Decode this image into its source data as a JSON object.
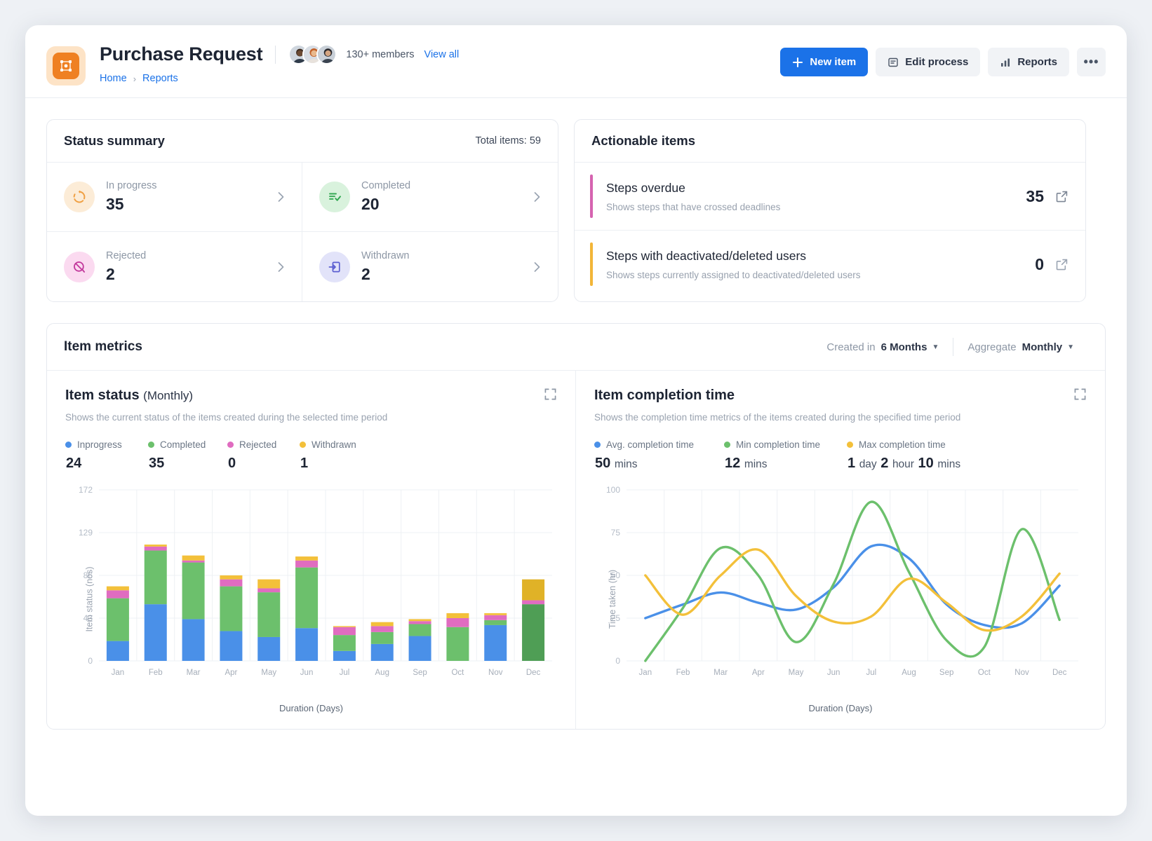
{
  "header": {
    "app_icon": "grid-app-icon",
    "title": "Purchase Request",
    "members_count": "130+ members",
    "view_all": "View all",
    "breadcrumb": {
      "home": "Home",
      "separator": "›",
      "current": "Reports"
    },
    "actions": {
      "new_item": "New item",
      "edit_process": "Edit process",
      "reports": "Reports",
      "more": "•••"
    },
    "accent_blue": "#1b72e8",
    "icon_orange": "#ef8022"
  },
  "status_summary": {
    "title": "Status summary",
    "total_label": "Total items: 59",
    "tiles": [
      {
        "label": "In progress",
        "value": "35",
        "icon": "in-progress-icon",
        "bg": "#fcecd7",
        "fg": "#f0a043"
      },
      {
        "label": "Completed",
        "value": "20",
        "icon": "completed-icon",
        "bg": "#d9f2dd",
        "fg": "#34a853"
      },
      {
        "label": "Rejected",
        "value": "2",
        "icon": "rejected-icon",
        "bg": "#fbdaf0",
        "fg": "#c2379b"
      },
      {
        "label": "Withdrawn",
        "value": "2",
        "icon": "withdrawn-icon",
        "bg": "#e2e3f9",
        "fg": "#5c5fd1"
      }
    ]
  },
  "actionable_items": {
    "title": "Actionable items",
    "rows": [
      {
        "title": "Steps overdue",
        "subtitle": "Shows steps that have crossed deadlines",
        "value": "35",
        "bar_color": "#d563b0"
      },
      {
        "title": "Steps with deactivated/deleted users",
        "subtitle": "Shows steps currently assigned to deactivated/deleted users",
        "value": "0",
        "bar_color": "#f2b538"
      }
    ]
  },
  "item_metrics": {
    "title": "Item metrics",
    "created_in": {
      "label": "Created in",
      "value": "6 Months"
    },
    "aggregate": {
      "label": "Aggregate",
      "value": "Monthly"
    }
  },
  "item_status": {
    "title": "Item status",
    "subtitle": "(Monthly)",
    "description": "Shows the current status of the items created during the selected time period",
    "expand_icon": "expand-icon",
    "legend": [
      {
        "label": "Inprogress",
        "value": "24",
        "color": "#4a90e8"
      },
      {
        "label": "Completed",
        "value": "35",
        "color": "#6cc06c"
      },
      {
        "label": "Rejected",
        "value": "0",
        "color": "#e06cc0"
      },
      {
        "label": "Withdrawn",
        "value": "1",
        "color": "#f3c03a"
      }
    ]
  },
  "item_completion": {
    "title": "Item completion time",
    "description": "Shows the completion time metrics of the items created during the specified time period",
    "expand_icon": "expand-icon",
    "legend": [
      {
        "label": "Avg. completion time",
        "value": "50",
        "unit": "mins",
        "color": "#4a90e8"
      },
      {
        "label": "Min completion time",
        "value": "12",
        "unit": "mins",
        "color": "#6cc06c"
      },
      {
        "label": "Max completion time",
        "value": "1",
        "unit": "day",
        "value2": "2",
        "unit2": "hour",
        "value3": "10",
        "unit3": "mins",
        "color": "#f3c03a"
      }
    ]
  },
  "chart_data": [
    {
      "type": "bar",
      "id": "item-status-bar",
      "title": "Item status (Monthly)",
      "stacked": true,
      "xlabel": "Duration (Days)",
      "ylabel": "Item status (nos)",
      "ylim": [
        0,
        172
      ],
      "yticks": [
        0,
        43,
        86,
        129,
        172
      ],
      "grid": true,
      "legend_position": "top-left",
      "categories": [
        "Jan",
        "Feb",
        "Mar",
        "Apr",
        "May",
        "Jun",
        "Jul",
        "Aug",
        "Sep",
        "Oct",
        "Nov",
        "Dec"
      ],
      "series": [
        {
          "name": "Inprogress",
          "color": "#4a90e8",
          "values": [
            20,
            57,
            42,
            30,
            24,
            33,
            10,
            17,
            25,
            0,
            36,
            0
          ]
        },
        {
          "name": "Completed",
          "color": "#6cc06c",
          "values": [
            43,
            54,
            57,
            45,
            45,
            61,
            16,
            12,
            12,
            34,
            5,
            57
          ]
        },
        {
          "name": "Rejected",
          "color": "#e06cc0",
          "values": [
            8,
            4,
            2,
            7,
            4,
            7,
            8,
            6,
            3,
            9,
            5,
            4
          ]
        },
        {
          "name": "Withdrawn",
          "color": "#f3c03a",
          "values": [
            4,
            2,
            5,
            4,
            9,
            4,
            1,
            4,
            2,
            5,
            2,
            21
          ]
        }
      ],
      "highlighted_category": "Dec"
    },
    {
      "type": "line",
      "id": "item-completion-line",
      "title": "Item completion time",
      "xlabel": "Duration (Days)",
      "ylabel": "Time taken (hr)",
      "ylim": [
        0,
        100
      ],
      "yticks": [
        0,
        25,
        50,
        75,
        100
      ],
      "grid": true,
      "legend_position": "top-left",
      "smooth": true,
      "categories": [
        "Jan",
        "Feb",
        "Mar",
        "Apr",
        "May",
        "Jun",
        "Jul",
        "Aug",
        "Sep",
        "Oct",
        "Nov",
        "Dec"
      ],
      "series": [
        {
          "name": "Avg. completion time",
          "color": "#4a90e8",
          "values": [
            25,
            33,
            40,
            34,
            30,
            43,
            67,
            60,
            33,
            21,
            22,
            44
          ]
        },
        {
          "name": "Min completion time",
          "color": "#6cc06c",
          "values": [
            0,
            31,
            66,
            50,
            11,
            45,
            93,
            52,
            12,
            8,
            77,
            24
          ]
        },
        {
          "name": "Max completion time",
          "color": "#f3c03a",
          "values": [
            50,
            27,
            50,
            65,
            38,
            23,
            26,
            48,
            34,
            18,
            26,
            51
          ]
        }
      ]
    }
  ]
}
